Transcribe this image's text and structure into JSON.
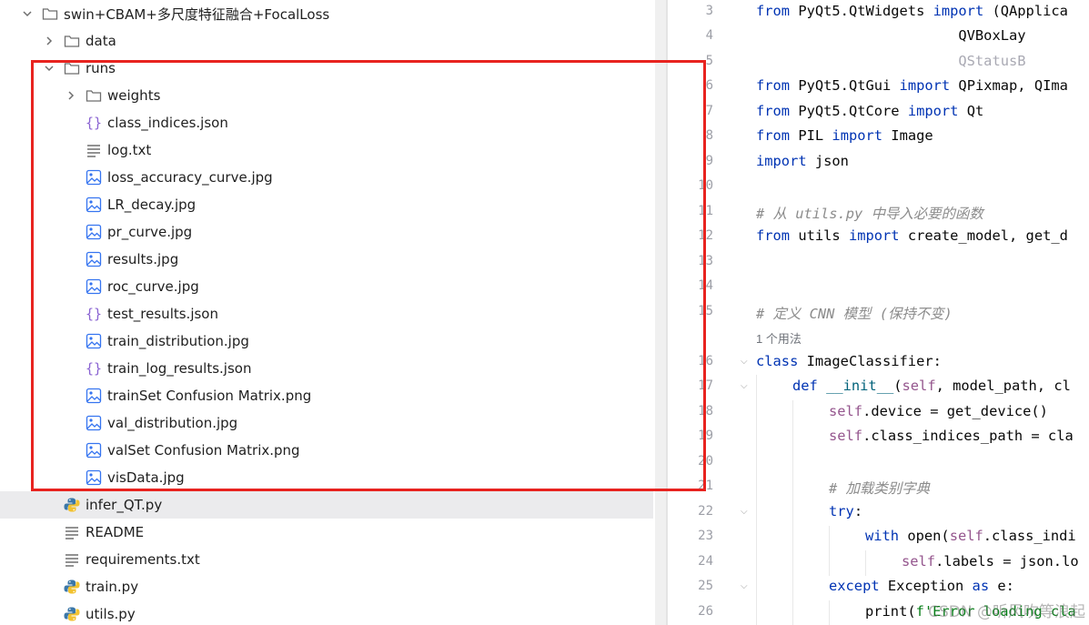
{
  "project_tree": {
    "root": "swin+CBAM+多尺度特征融合+FocalLoss",
    "items": [
      {
        "label": "data",
        "type": "folder",
        "state": "collapsed"
      },
      {
        "label": "runs",
        "type": "folder",
        "state": "expanded"
      },
      {
        "label": "weights",
        "type": "folder",
        "state": "collapsed"
      },
      {
        "label": "class_indices.json",
        "type": "json"
      },
      {
        "label": "log.txt",
        "type": "text"
      },
      {
        "label": "loss_accuracy_curve.jpg",
        "type": "image"
      },
      {
        "label": "LR_decay.jpg",
        "type": "image"
      },
      {
        "label": "pr_curve.jpg",
        "type": "image"
      },
      {
        "label": "results.jpg",
        "type": "image"
      },
      {
        "label": "roc_curve.jpg",
        "type": "image"
      },
      {
        "label": "test_results.json",
        "type": "json"
      },
      {
        "label": "train_distribution.jpg",
        "type": "image"
      },
      {
        "label": "train_log_results.json",
        "type": "json"
      },
      {
        "label": "trainSet Confusion Matrix.png",
        "type": "image"
      },
      {
        "label": "val_distribution.jpg",
        "type": "image"
      },
      {
        "label": "valSet Confusion Matrix.png",
        "type": "image"
      },
      {
        "label": "visData.jpg",
        "type": "image"
      },
      {
        "label": "infer_QT.py",
        "type": "python",
        "selected": true
      },
      {
        "label": "README",
        "type": "text"
      },
      {
        "label": "requirements.txt",
        "type": "text"
      },
      {
        "label": "train.py",
        "type": "python"
      },
      {
        "label": "utils.py",
        "type": "python"
      }
    ]
  },
  "editor": {
    "line_numbers": [
      "3",
      "4",
      "5",
      "6",
      "7",
      "8",
      "9",
      "10",
      "11",
      "12",
      "13",
      "14",
      "15",
      "",
      "16",
      "17",
      "18",
      "19",
      "20",
      "21",
      "22",
      "23",
      "24",
      "25",
      "26"
    ],
    "usage_hint": "1 个用法",
    "lines": {
      "l3_kw1": "from",
      "l3_mod": " PyQt5.QtWidgets ",
      "l3_kw2": "import",
      "l3_rest": " (QApplica",
      "l4": "                        QVBoxLay",
      "l5": "                        QStatusB",
      "l6_kw1": "from",
      "l6_mod": " PyQt5.QtGui ",
      "l6_kw2": "import",
      "l6_rest": " QPixmap, QIma",
      "l7_kw1": "from",
      "l7_mod": " PyQt5.QtCore ",
      "l7_kw2": "import",
      "l7_rest": " Qt",
      "l8_kw1": "from",
      "l8_mod": " PIL ",
      "l8_kw2": "import",
      "l8_rest": " Image",
      "l9_kw": "import",
      "l9_rest": " json",
      "l11": "# 从 utils.py 中导入必要的函数",
      "l12_kw1": "from",
      "l12_mod": " utils ",
      "l12_kw2": "import",
      "l12_rest": " create_model, get_d",
      "l15": "# 定义 CNN 模型 (保持不变)",
      "l16_kw": "class",
      "l16_rest": " ImageClassifier:",
      "l17_kw": "def",
      "l17_fn": "__init__",
      "l17_a": "(",
      "l17_self": "self",
      "l17_b": ", model_path, cl",
      "l18_self": "self",
      "l18_rest": ".device = get_device()",
      "l19_self": "self",
      "l19_rest": ".class_indices_path = cla",
      "l21": "# 加载类别字典",
      "l22_kw": "try",
      "l22_rest": ":",
      "l23_kw": "with",
      "l23_a": " open(",
      "l23_self": "self",
      "l23_rest": ".class_indi",
      "l24_self": "self",
      "l24_rest": ".labels = json.lo",
      "l25_kw1": "except",
      "l25_mid": " Exception ",
      "l25_kw2": "as",
      "l25_rest": " e:",
      "l26_a": "print(",
      "l26_str": "f'Error loading cla"
    }
  },
  "watermark": "CSDN @听风吹等浪起",
  "annotation": {
    "color": "#e8231f"
  }
}
